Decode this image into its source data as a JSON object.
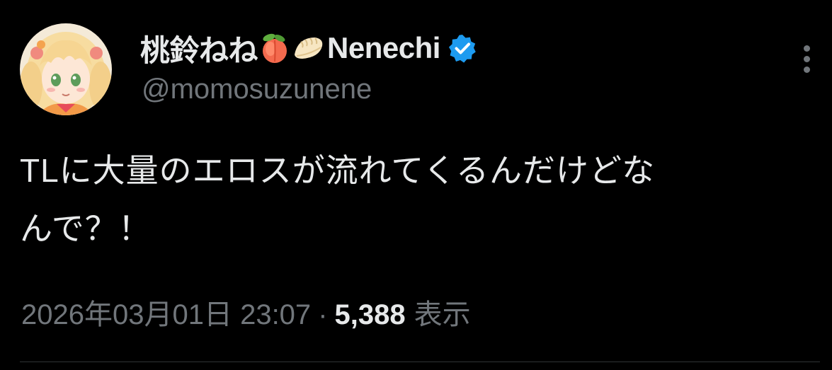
{
  "tweet": {
    "author": {
      "display_name": "桃鈴ねね",
      "name_emojis": [
        "peach-emoji",
        "dumpling-emoji"
      ],
      "name_suffix": "Nenechi",
      "handle": "@momosuzunene",
      "verified": true
    },
    "text_line1": "TLに大量のエロスが流れてくるんだけどな",
    "text_line2": "んで？！",
    "timestamp": "2026年03月01日 23:07",
    "separator": "·",
    "views_count": "5,388",
    "views_label": "表示"
  },
  "icons": {
    "more": "more-vertical-icon",
    "verified": "verified-badge-icon"
  },
  "colors": {
    "background": "#000000",
    "text_primary": "#e7e9ea",
    "text_secondary": "#71767b",
    "verified_blue": "#1d9bf0",
    "divider": "#2f3336"
  }
}
